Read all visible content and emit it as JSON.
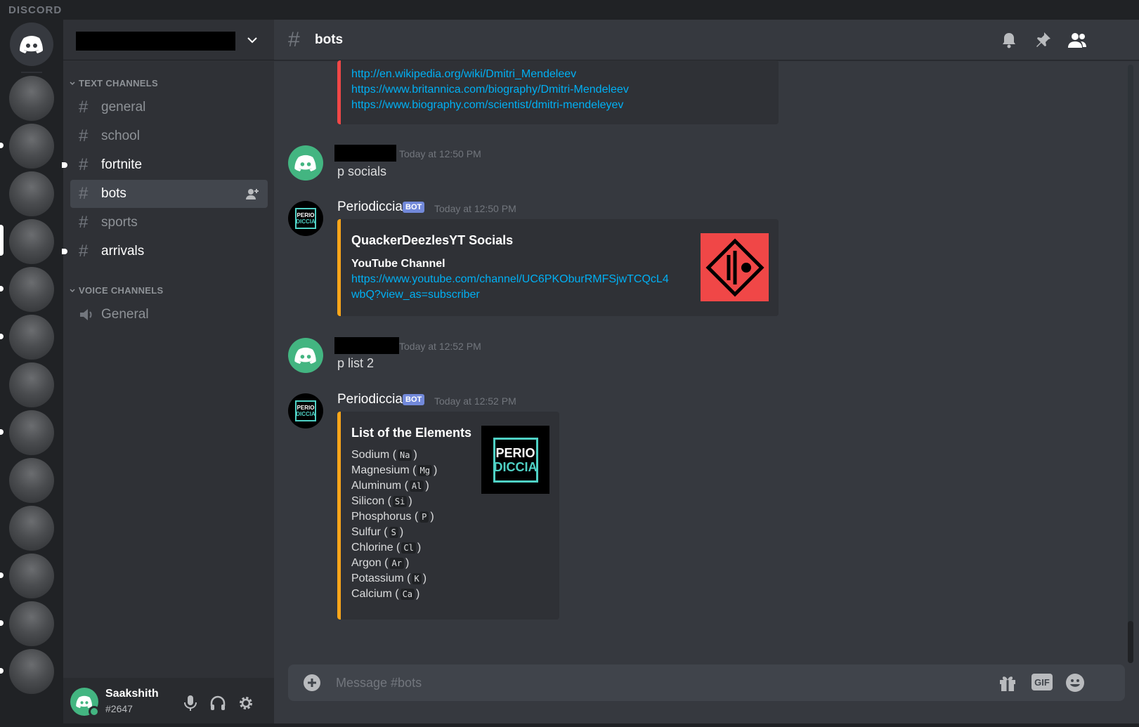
{
  "app": {
    "wordmark": "DISCORD"
  },
  "sidebar": {
    "categories": {
      "text": "TEXT CHANNELS",
      "voice": "VOICE CHANNELS"
    },
    "channels": [
      {
        "label": "general",
        "state": "read"
      },
      {
        "label": "school",
        "state": "read"
      },
      {
        "label": "fortnite",
        "state": "unread"
      },
      {
        "label": "bots",
        "state": "active"
      },
      {
        "label": "sports",
        "state": "read"
      },
      {
        "label": "arrivals",
        "state": "unread"
      }
    ],
    "voice_channels": [
      {
        "label": "General"
      }
    ]
  },
  "user": {
    "name": "Saakshith",
    "tag": "#2647"
  },
  "header": {
    "channel": "bots"
  },
  "messages": [
    {
      "type": "embed_links",
      "links": [
        "http://en.wikipedia.org/wiki/Dmitri_Mendeleev",
        "https://www.britannica.com/biography/Dmitri-Mendeleev",
        "https://www.biography.com/scientist/dmitri-mendeleyev"
      ]
    },
    {
      "type": "user",
      "timestamp": "Today at 12:50 PM",
      "content": "p socials"
    },
    {
      "type": "bot",
      "author": "Periodiccia",
      "badge": "BOT",
      "timestamp": "Today at 12:50 PM",
      "embed": {
        "title": "QuackerDeezlesYT Socials",
        "field_name": "YouTube Channel",
        "link_line1": "https://www.youtube.com/channel/UC6PKOburRMFSjwTCQcL4",
        "link_line2": "wbQ?view_as=subscriber"
      }
    },
    {
      "type": "user",
      "timestamp": "Today at 12:52 PM",
      "content": "p list 2"
    },
    {
      "type": "bot",
      "author": "Periodiccia",
      "badge": "BOT",
      "timestamp": "Today at 12:52 PM",
      "embed": {
        "title": "List of the Elements",
        "thumb_text_1": "PERIO",
        "thumb_text_2": "DICCIA",
        "elements": [
          {
            "name": "Sodium",
            "symbol": "Na"
          },
          {
            "name": "Magnesium",
            "symbol": "Mg"
          },
          {
            "name": "Aluminum",
            "symbol": "Al"
          },
          {
            "name": "Silicon",
            "symbol": "Si"
          },
          {
            "name": "Phosphorus",
            "symbol": "P"
          },
          {
            "name": "Sulfur",
            "symbol": "S"
          },
          {
            "name": "Chlorine",
            "symbol": "Cl"
          },
          {
            "name": "Argon",
            "symbol": "Ar"
          },
          {
            "name": "Potassium",
            "symbol": "K"
          },
          {
            "name": "Calcium",
            "symbol": "Ca"
          }
        ]
      }
    }
  ],
  "composer": {
    "placeholder": "Message #bots",
    "gif_label": "GIF"
  },
  "colors": {
    "accent_red": "#f04747",
    "accent_orange": "#faa61a",
    "brand": "#7289da",
    "online": "#43b581",
    "link": "#00b0f4"
  }
}
